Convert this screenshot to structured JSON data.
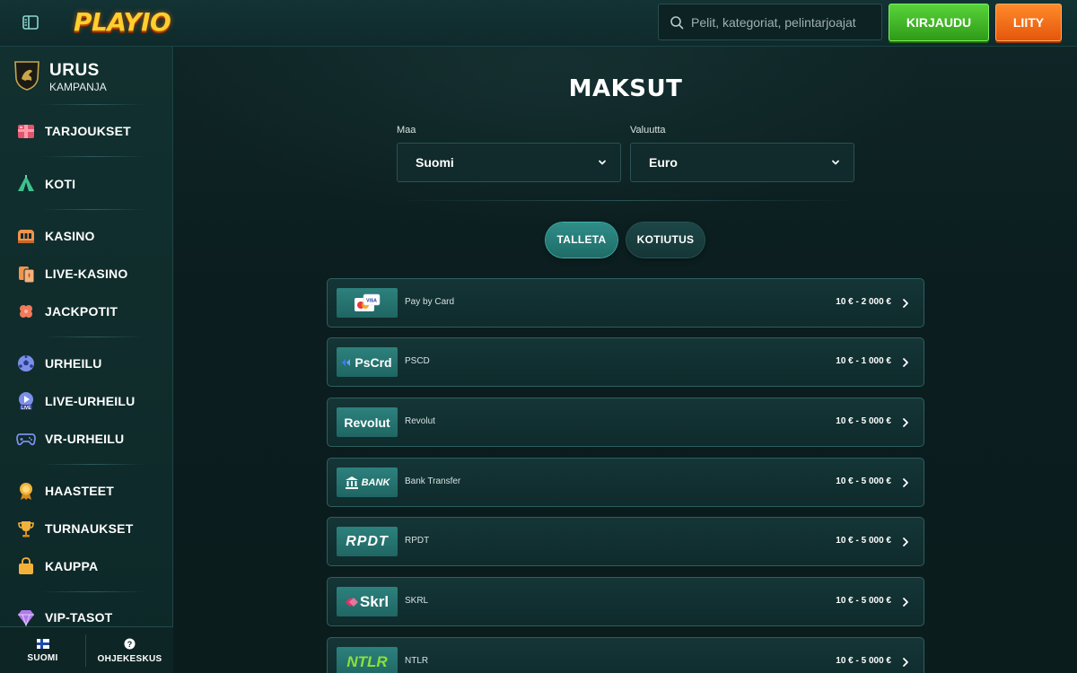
{
  "header": {
    "logo_text": "PLAYIO",
    "search_placeholder": "Pelit, kategoriat, pelintarjoajat",
    "login_label": "KIRJAUDU",
    "join_label": "LIITY"
  },
  "sidebar": {
    "campaign": {
      "title": "URUS",
      "subtitle": "KAMPANJA"
    },
    "items": [
      {
        "label": "TARJOUKSET",
        "icon": "gift-box-icon"
      },
      {
        "label": "KOTI",
        "icon": "tent-home-icon"
      },
      {
        "label": "KASINO",
        "icon": "slot-machine-icon"
      },
      {
        "label": "LIVE-KASINO",
        "icon": "playing-cards-icon"
      },
      {
        "label": "JACKPOTIT",
        "icon": "clover-icon"
      },
      {
        "label": "URHEILU",
        "icon": "soccer-ball-icon"
      },
      {
        "label": "LIVE-URHEILU",
        "icon": "live-play-icon"
      },
      {
        "label": "VR-URHEILU",
        "icon": "gamepad-icon"
      },
      {
        "label": "HAASTEET",
        "icon": "medal-icon"
      },
      {
        "label": "TURNAUKSET",
        "icon": "trophy-icon"
      },
      {
        "label": "KAUPPA",
        "icon": "shopping-bag-icon"
      },
      {
        "label": "VIP-TASOT",
        "icon": "diamond-icon"
      }
    ],
    "bottom": {
      "language_label": "SUOMI",
      "help_label": "OHJEKESKUS"
    }
  },
  "main": {
    "title": "MAKSUT",
    "country": {
      "label": "Maa",
      "value": "Suomi"
    },
    "currency": {
      "label": "Valuutta",
      "value": "Euro"
    },
    "tabs": [
      {
        "label": "TALLETA",
        "active": true
      },
      {
        "label": "KOTIUTUS",
        "active": false
      }
    ],
    "payment_methods": [
      {
        "name": "Pay by Card",
        "range": "10 € - 2 000 €",
        "logo": "card"
      },
      {
        "name": "PSCD",
        "range": "10 € - 1 000 €",
        "logo": "PsCrd"
      },
      {
        "name": "Revolut",
        "range": "10 € - 5 000 €",
        "logo": "Revolut"
      },
      {
        "name": "Bank Transfer",
        "range": "10 € - 5 000 €",
        "logo": "BANK"
      },
      {
        "name": "RPDT",
        "range": "10 € - 5 000 €",
        "logo": "RPDT"
      },
      {
        "name": "SKRL",
        "range": "10 € - 5 000 €",
        "logo": "Skrl"
      },
      {
        "name": "NTLR",
        "range": "10 € - 5 000 €",
        "logo": "NTLR"
      }
    ]
  },
  "colors": {
    "background": "#0c1e1f",
    "accent_teal": "#2f8d88",
    "login_green": "#3fb622",
    "join_orange": "#f26a1a",
    "logo_yellow": "#ffcf2e"
  }
}
